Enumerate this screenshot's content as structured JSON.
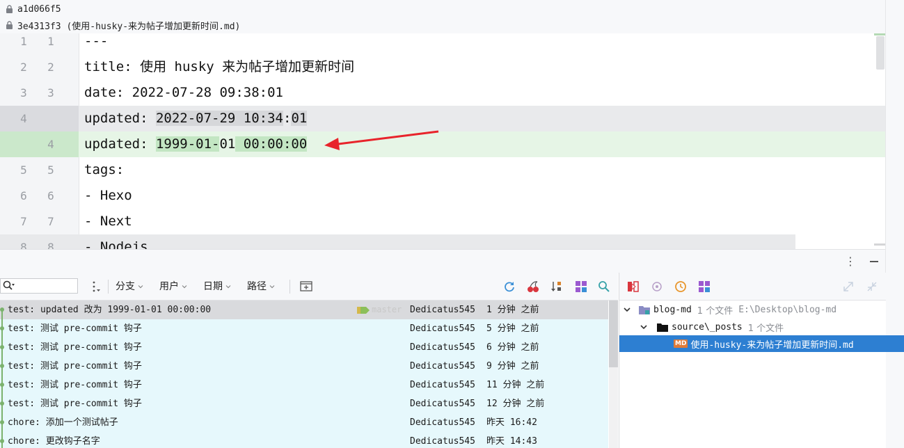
{
  "revisions": {
    "left": "a1d066f5",
    "right": "3e4313f3 (使用-husky-来为帖子增加更新时间.md)"
  },
  "diff": {
    "lines": [
      {
        "a": "1",
        "b": "1",
        "text": "---"
      },
      {
        "a": "2",
        "b": "2",
        "text": "title: 使用 husky 来为帖子增加更新时间"
      },
      {
        "a": "3",
        "b": "3",
        "text": "date: 2022-07-28 09:38:01"
      },
      {
        "a": "4",
        "b": "",
        "prefix": "updated: ",
        "hl1": "2022-07-29 10:34",
        "mid": ":",
        "hl2": "01",
        "rest": ""
      },
      {
        "a": "",
        "b": "4",
        "prefix": "updated: ",
        "hl1": "1999-01-",
        "mid": "01",
        "hl2": " 00:00:00",
        "rest": ""
      },
      {
        "a": "5",
        "b": "5",
        "text": "tags:"
      },
      {
        "a": "6",
        "b": "6",
        "text": "- Hexo"
      },
      {
        "a": "7",
        "b": "7",
        "text": "- Next"
      },
      {
        "a": "8",
        "b": "8",
        "text": "- Nodejs"
      }
    ]
  },
  "toolbar": {
    "search_placeholder": "",
    "filters": [
      "分支",
      "用户",
      "日期",
      "路径"
    ]
  },
  "commits": [
    {
      "message": "test: updated 改为 1999-01-01 00:00:00",
      "author": "Dedicatus545",
      "date": "1 分钟 之前",
      "branch": "master"
    },
    {
      "message": "test: 测试 pre-commit 钩子",
      "author": "Dedicatus545",
      "date": "5 分钟 之前"
    },
    {
      "message": "test: 测试 pre-commit 钩子",
      "author": "Dedicatus545",
      "date": "6 分钟 之前"
    },
    {
      "message": "test: 测试 pre-commit 钩子",
      "author": "Dedicatus545",
      "date": "9 分钟 之前"
    },
    {
      "message": "test: 测试 pre-commit 钩子",
      "author": "Dedicatus545",
      "date": "11 分钟 之前"
    },
    {
      "message": "test: 测试 pre-commit 钩子",
      "author": "Dedicatus545",
      "date": "12 分钟 之前"
    },
    {
      "message": "chore: 添加一个测试帖子",
      "author": "Dedicatus545",
      "date": "昨天 16:42"
    },
    {
      "message": "chore: 更改钩子名字",
      "author": "Dedicatus545",
      "date": "昨天 14:43"
    }
  ],
  "changes_tree": {
    "root": {
      "name": "blog-md",
      "count": "1 个文件",
      "path": "E:\\Desktop\\blog-md"
    },
    "folder": {
      "name": "source\\_posts",
      "count": "1 个文件"
    },
    "file": {
      "badge": "MD",
      "name": "使用-husky-来为帖子增加更新时间.md"
    }
  },
  "colors": {
    "added_bg": "#e6f5e6",
    "added_hl": "#c3e6c3",
    "selection": "#2d7fd2",
    "commit_row": "#e6f8fc",
    "graph": "#7bb26d",
    "arrow": "#e8242b"
  },
  "icons": [
    "lock-icon",
    "search-icon",
    "refresh-icon",
    "cherry-pick-icon",
    "sort-icon",
    "intellisort-icon",
    "find-icon",
    "diff-icon",
    "revert-icon",
    "history-icon",
    "group-icon",
    "expand-icon",
    "collapse-icon",
    "more-icon",
    "minimize-icon",
    "new-tab-icon"
  ]
}
